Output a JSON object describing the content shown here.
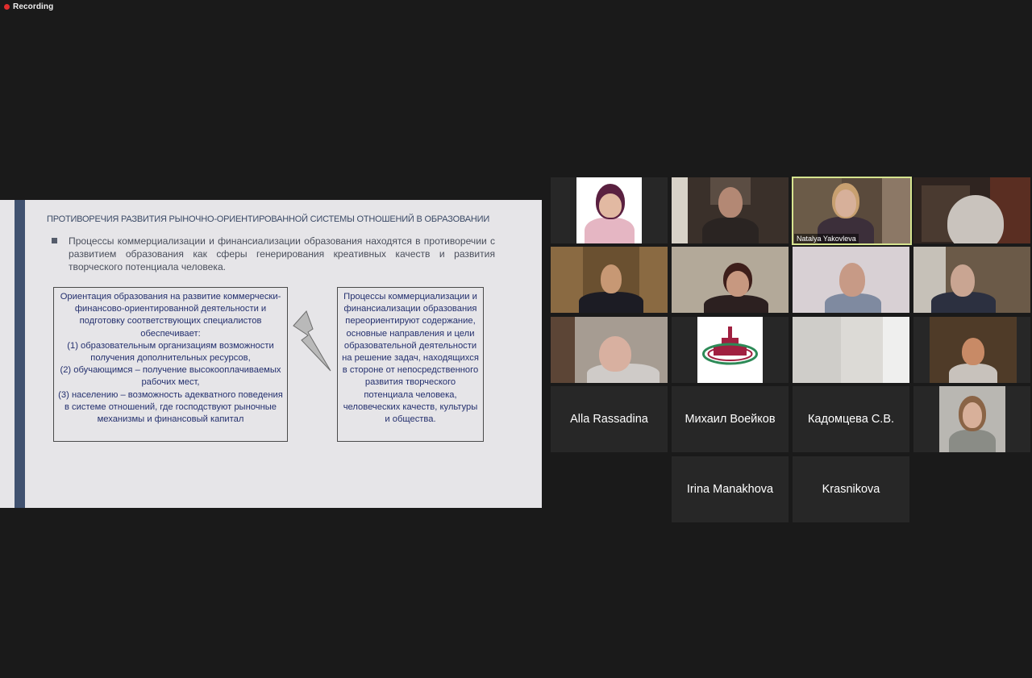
{
  "recording": {
    "label": "Recording",
    "dot_color": "#e02d2d"
  },
  "slide": {
    "title": "ПРОТИВОРЕЧИЯ РАЗВИТИЯ РЫНОЧНО-ОРИЕНТИРОВАННОЙ СИСТЕМЫ ОТНОШЕНИЙ В ОБРАЗОВАНИИ",
    "bullet": "Процессы коммерциализации и финансиализации образования находятся в противоречии с развитием образования как сферы генерирования креативных качеств и развития творческого потенциала человека.",
    "left_box": "Ориентация образования на развитие коммерчески-финансово-ориентированной деятельности и подготовку соответствующих специалистов обеспечивает:\n(1) образовательным организациям возможности получения дополнительных ресурсов,\n(2)  обучающимся – получение высокооплачиваемых рабочих мест,\n(3)  населению – возможность адекватного поведения в системе отношений, где господствуют рыночные механизмы и финансовый капитал",
    "right_box": "Процессы коммерциализации и финансиализации образования переориентируют содержание, основные направления и цели образовательной деятельности на решение задач, находящихся в стороне от непосредственного развития творческого потенциала человека, человеческих качеств, культуры и общества.",
    "accent_color": "#415270"
  },
  "participants": {
    "active_speaker": "Natalya Yakovleva",
    "active_border_color": "#d6e48f",
    "names": {
      "alla": "Alla Rassadina",
      "mikhail": "Михаил Воейков",
      "kadomtseva": "Кадомцева С.В.",
      "irina": "Irina Manakhova",
      "krasnikova": "Krasnikova"
    }
  }
}
